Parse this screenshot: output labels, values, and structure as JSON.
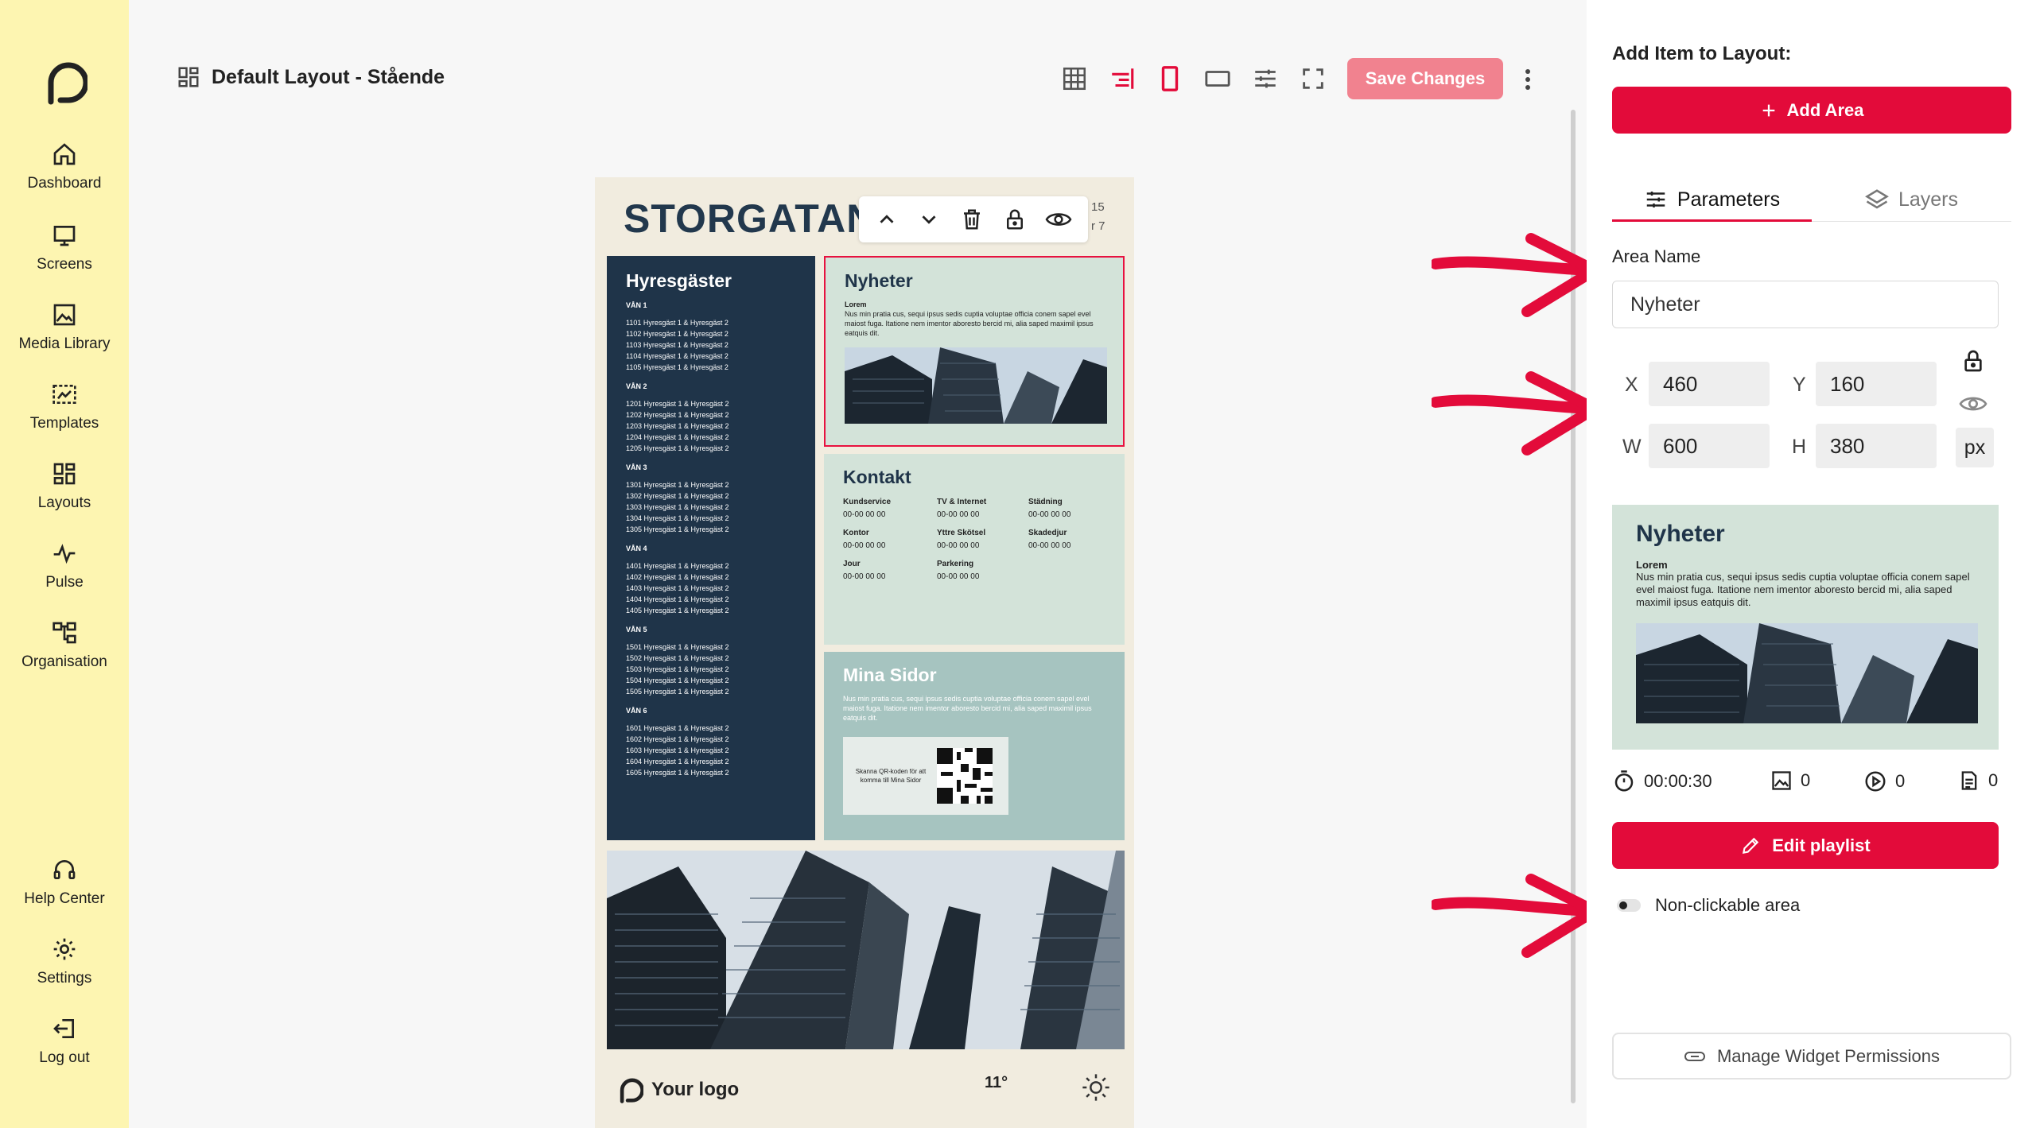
{
  "sidebar": {
    "items": [
      {
        "label": "Dashboard",
        "icon": "home-icon"
      },
      {
        "label": "Screens",
        "icon": "monitor-icon"
      },
      {
        "label": "Media Library",
        "icon": "image-icon"
      },
      {
        "label": "Templates",
        "icon": "template-icon"
      },
      {
        "label": "Layouts",
        "icon": "layout-icon"
      },
      {
        "label": "Pulse",
        "icon": "pulse-icon"
      },
      {
        "label": "Organisation",
        "icon": "org-icon"
      }
    ],
    "bottom": [
      {
        "label": "Help Center",
        "icon": "headset-icon"
      },
      {
        "label": "Settings",
        "icon": "gear-icon"
      },
      {
        "label": "Log out",
        "icon": "logout-icon"
      }
    ]
  },
  "topbar": {
    "title": "Default Layout - Stående",
    "save_label": "Save Changes"
  },
  "canvas": {
    "title": "STORGATAN",
    "time_fragment_1": "15",
    "time_fragment_2": "r 7",
    "tenants": {
      "title": "Hyresgäster",
      "floors": [
        {
          "name": "VÅN 1",
          "rows": [
            "1101 Hyresgäst 1 & Hyresgäst 2",
            "1102 Hyresgäst 1 & Hyresgäst 2",
            "1103 Hyresgäst 1 & Hyresgäst 2",
            "1104 Hyresgäst 1 & Hyresgäst 2",
            "1105 Hyresgäst 1 & Hyresgäst 2"
          ]
        },
        {
          "name": "VÅN 2",
          "rows": [
            "1201 Hyresgäst 1 & Hyresgäst 2",
            "1202 Hyresgäst 1 & Hyresgäst 2",
            "1203 Hyresgäst 1 & Hyresgäst 2",
            "1204 Hyresgäst 1 & Hyresgäst 2",
            "1205 Hyresgäst 1 & Hyresgäst 2"
          ]
        },
        {
          "name": "VÅN 3",
          "rows": [
            "1301 Hyresgäst 1 & Hyresgäst 2",
            "1302 Hyresgäst 1 & Hyresgäst 2",
            "1303 Hyresgäst 1 & Hyresgäst 2",
            "1304 Hyresgäst 1 & Hyresgäst 2",
            "1305 Hyresgäst 1 & Hyresgäst 2"
          ]
        },
        {
          "name": "VÅN 4",
          "rows": [
            "1401 Hyresgäst 1 & Hyresgäst 2",
            "1402 Hyresgäst 1 & Hyresgäst 2",
            "1403 Hyresgäst 1 & Hyresgäst 2",
            "1404 Hyresgäst 1 & Hyresgäst 2",
            "1405 Hyresgäst 1 & Hyresgäst 2"
          ]
        },
        {
          "name": "VÅN 5",
          "rows": [
            "1501 Hyresgäst 1 & Hyresgäst 2",
            "1502 Hyresgäst 1 & Hyresgäst 2",
            "1503 Hyresgäst 1 & Hyresgäst 2",
            "1504 Hyresgäst 1 & Hyresgäst 2",
            "1505 Hyresgäst 1 & Hyresgäst 2"
          ]
        },
        {
          "name": "VÅN 6",
          "rows": [
            "1601 Hyresgäst 1 & Hyresgäst 2",
            "1602 Hyresgäst 1 & Hyresgäst 2",
            "1603 Hyresgäst 1 & Hyresgäst 2",
            "1604 Hyresgäst 1 & Hyresgäst 2",
            "1605 Hyresgäst 1 & Hyresgäst 2"
          ]
        }
      ]
    },
    "news": {
      "title": "Nyheter",
      "subtitle": "Lorem",
      "body": "Nus min pratia cus, sequi ipsus sedis cuptia voluptae officia conem sapel evel maiost fuga. Itatione nem imentor aboresto bercid mi, alia saped maximil ipsus eatquis dit."
    },
    "contact": {
      "title": "Kontakt",
      "items": [
        {
          "name": "Kundservice",
          "phone": "00-00 00 00"
        },
        {
          "name": "TV & Internet",
          "phone": "00-00 00 00"
        },
        {
          "name": "Städning",
          "phone": "00-00 00 00"
        },
        {
          "name": "Kontor",
          "phone": "00-00 00 00"
        },
        {
          "name": "Yttre Skötsel",
          "phone": "00-00 00 00"
        },
        {
          "name": "Skadedjur",
          "phone": "00-00 00 00"
        },
        {
          "name": "Jour",
          "phone": "00-00 00 00"
        },
        {
          "name": "Parkering",
          "phone": "00-00 00 00"
        }
      ]
    },
    "mina_sidor": {
      "title": "Mina Sidor",
      "body": "Nus min pratia cus, sequi ipsus sedis cuptia voluptae officia conem sapel evel maiost fuga. Itatione nem imentor aboresto bercid mi, alia saped maximil ipsus eatquis dit.",
      "qr_text": "Skanna QR-koden för att komma till Mina Sidor"
    },
    "footer": {
      "logo_text": "Your logo",
      "temperature": "11°"
    }
  },
  "panel": {
    "add_item_label": "Add Item to Layout:",
    "add_area_label": "Add Area",
    "tabs": [
      "Parameters",
      "Layers"
    ],
    "area_name_label": "Area Name",
    "area_name_value": "Nyheter",
    "coords": {
      "x_label": "X",
      "x_value": "460",
      "y_label": "Y",
      "y_value": "160",
      "w_label": "W",
      "w_value": "600",
      "h_label": "H",
      "h_value": "380",
      "unit": "px"
    },
    "preview": {
      "title": "Nyheter",
      "subtitle": "Lorem",
      "body": "Nus min pratia cus, sequi ipsus sedis cuptia voluptae officia conem sapel evel maiost fuga. Itatione nem imentor aboresto bercid mi, alia saped maximil ipsus eatquis dit."
    },
    "stats": {
      "duration": "00:00:30",
      "images": "0",
      "videos": "0",
      "documents": "0"
    },
    "edit_playlist_label": "Edit playlist",
    "non_clickable_label": "Non-clickable area",
    "manage_permissions_label": "Manage Widget Permissions"
  },
  "colors": {
    "accent": "#e30b3a",
    "sidebar_bg": "#fdf5b1",
    "navy": "#1f3449",
    "mint": "#d3e3d9"
  }
}
